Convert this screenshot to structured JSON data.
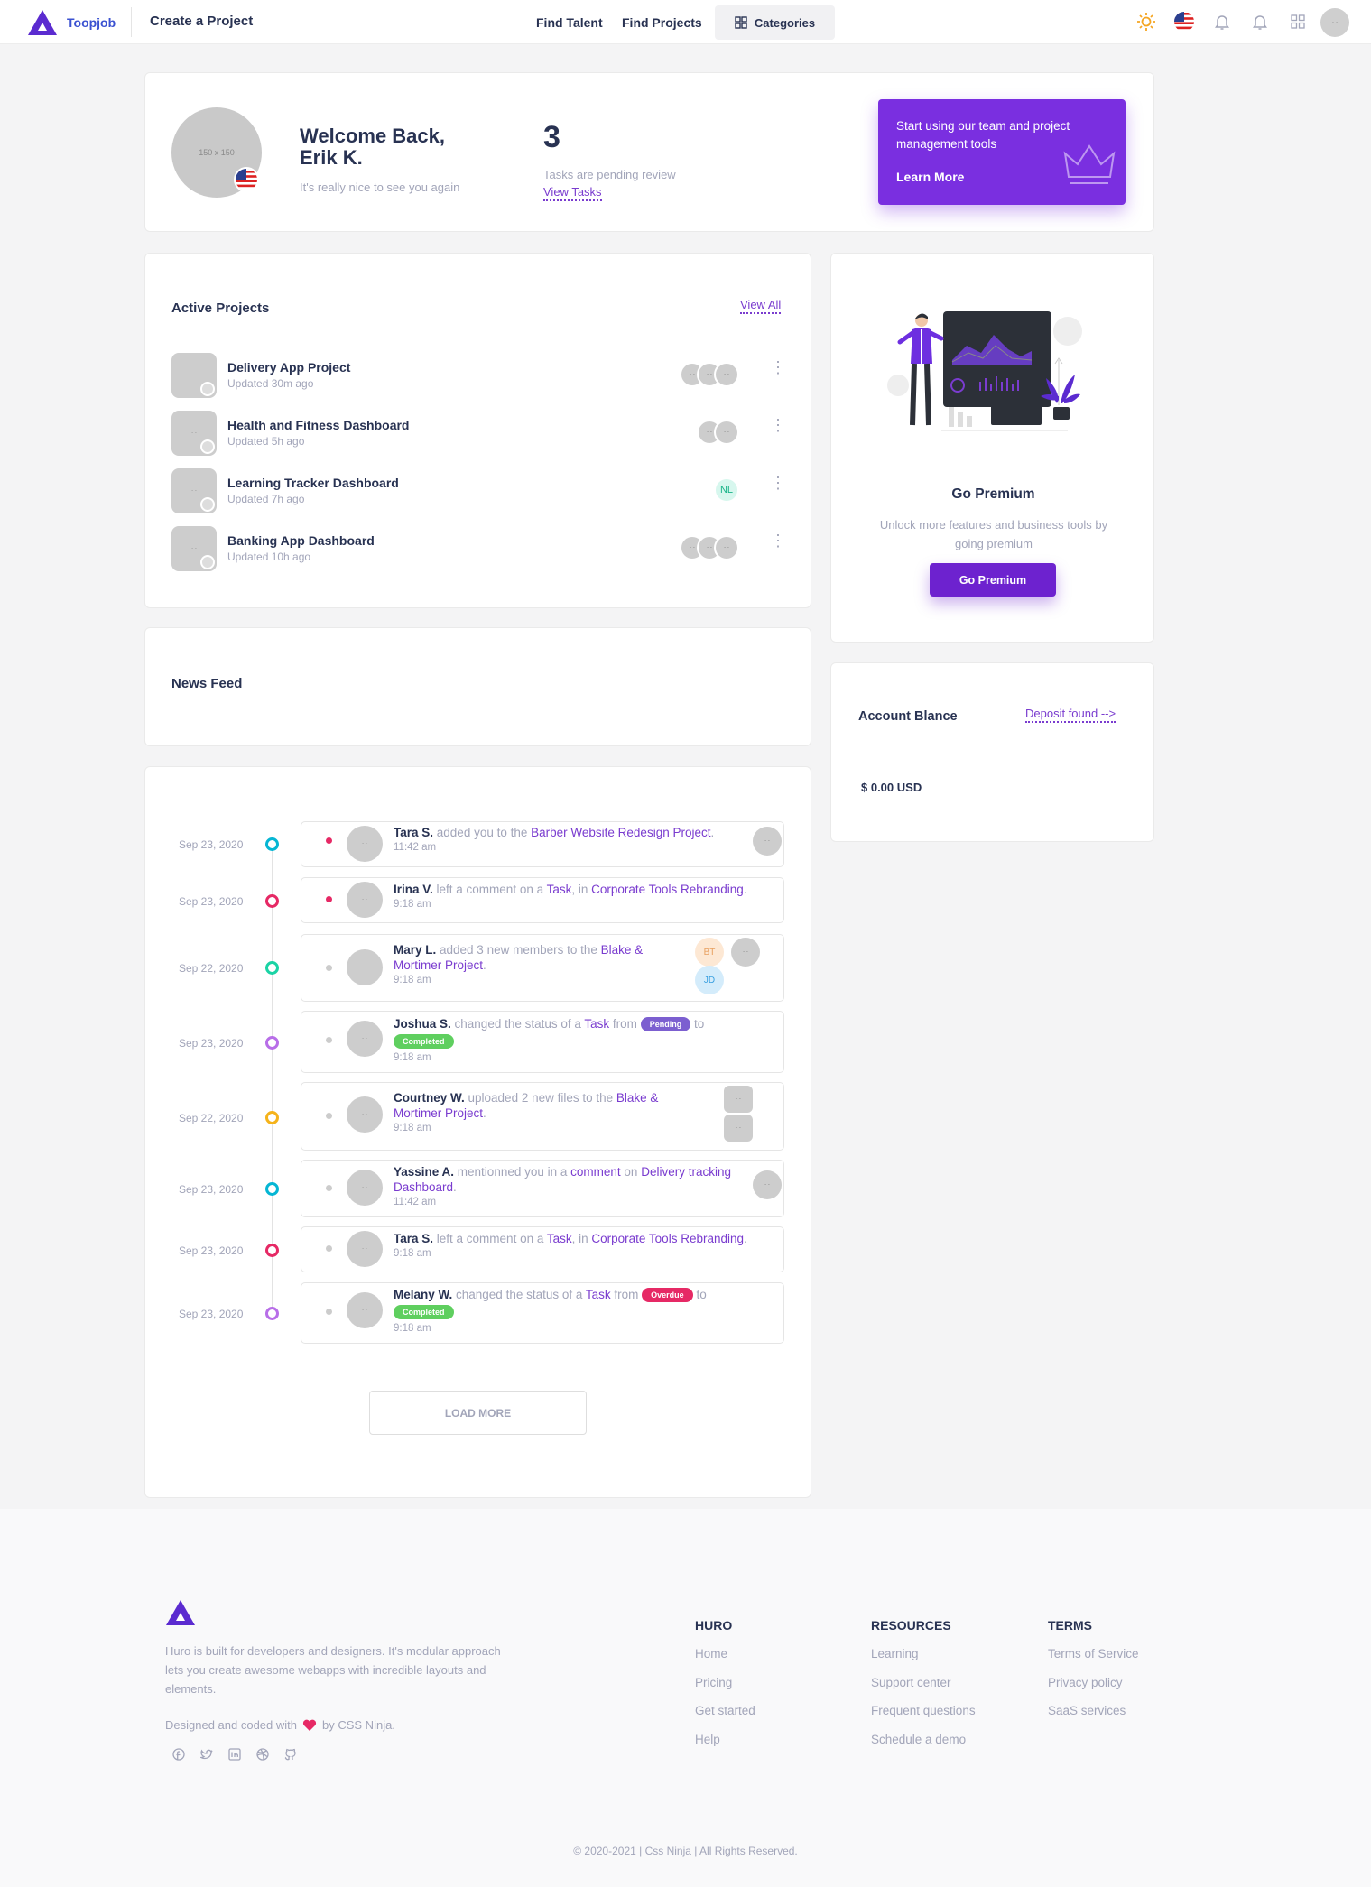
{
  "nav": {
    "brand": "Toopjob",
    "title": "Create a Project",
    "links": [
      "Find Talent",
      "Find Projects"
    ],
    "categories_label": "Categories",
    "avatar_label": "- -"
  },
  "welcome": {
    "avatar_label": "150 x 150",
    "title": "Welcome Back, Erik K.",
    "subtitle": "It's really nice to see you again",
    "tasks_count": "3",
    "tasks_label": "Tasks are pending review",
    "tasks_link": "View Tasks"
  },
  "promo": {
    "text": "Start using our team and project management tools",
    "link": "Learn More"
  },
  "active_projects": {
    "title": "Active Projects",
    "view_all": "View All",
    "items": [
      {
        "name": "Delivery App Project",
        "updated": "Updated 30m ago"
      },
      {
        "name": "Health and Fitness Dashboard",
        "updated": "Updated 5h ago"
      },
      {
        "name": "Learning Tracker Dashboard",
        "updated": "Updated 7h ago",
        "avatar_initials": "NL"
      },
      {
        "name": "Banking App Dashboard",
        "updated": "Updated 10h ago"
      }
    ]
  },
  "premium": {
    "title": "Go Premium",
    "text": "Unlock more features and business tools by going premium",
    "button": "Go Premium"
  },
  "news_feed": {
    "title": "News Feed"
  },
  "account": {
    "title": "Account Blance",
    "link": "Deposit found -->",
    "balance": "$ 0.00 USD"
  },
  "timeline": [
    {
      "date": "Sep 23, 2020",
      "color": "#06b6d4",
      "bullet": "#e62965",
      "name": "Tara S.",
      "a": " added you to the ",
      "l1": "Barber Website Redesign Project",
      "b": ".",
      "time": "11:42 am"
    },
    {
      "date": "Sep 23, 2020",
      "color": "#e62965",
      "bullet": "#e62965",
      "name": "Irina V.",
      "a": " left a comment on a ",
      "l1": "Task",
      "b": ", in ",
      "l2": "Corporate Tools Rebranding",
      "c": ".",
      "time": "9:18 am"
    },
    {
      "date": "Sep 22, 2020",
      "color": "#1bd3a5",
      "bullet": "#cccccc",
      "name": "Mary L.",
      "a": " added 3 new members to the ",
      "l1": "Blake & Mortimer Project",
      "b": ".",
      "time": "9:18 am",
      "initials": [
        "BT",
        "JD"
      ]
    },
    {
      "date": "Sep 23, 2020",
      "color": "#b86ee8",
      "bullet": "#cccccc",
      "name": "Joshua S.",
      "a": " changed the status of a ",
      "l1": "Task",
      "b": " from ",
      "pill1": "Pending",
      "c": " to ",
      "pill2": "Completed",
      "time": "9:18 am"
    },
    {
      "date": "Sep 22, 2020",
      "color": "#f5b31b",
      "bullet": "#cccccc",
      "name": "Courtney W.",
      "a": " uploaded 2 new files to the ",
      "l1": "Blake & Mortimer Project",
      "b": ".",
      "time": "9:18 am"
    },
    {
      "date": "Sep 23, 2020",
      "color": "#06b6d4",
      "bullet": "#cccccc",
      "name": "Yassine A.",
      "a": " mentionned you in a ",
      "l1": "comment",
      "b": " on ",
      "l2": "Delivery tracking Dashboard",
      "c": ".",
      "time": "11:42 am"
    },
    {
      "date": "Sep 23, 2020",
      "color": "#e62965",
      "bullet": "#cccccc",
      "name": "Tara S.",
      "a": " left a comment on a ",
      "l1": "Task",
      "b": ", in ",
      "l2": "Corporate Tools Rebranding",
      "c": ".",
      "time": "9:18 am"
    },
    {
      "date": "Sep 23, 2020",
      "color": "#b86ee8",
      "bullet": "#cccccc",
      "name": "Melany W.",
      "a": " changed the status of a ",
      "l1": "Task",
      "b": " from ",
      "pill1": "Overdue",
      "c": " to ",
      "pill2": "Completed",
      "time": "9:18 am"
    }
  ],
  "load_more": "LOAD MORE",
  "placeholder_label": "- -",
  "footer": {
    "description": "Huro is built for developers and designers. It's modular approach lets you create awesome webapps with incredible layouts and elements.",
    "made_a": "Designed and coded with",
    "made_b": "by CSS Ninja.",
    "columns": [
      {
        "title": "HURO",
        "links": [
          "Home",
          "Pricing",
          "Get started",
          "Help"
        ]
      },
      {
        "title": "RESOURCES",
        "links": [
          "Learning",
          "Support center",
          "Frequent questions",
          "Schedule a demo"
        ]
      },
      {
        "title": "TERMS",
        "links": [
          "Terms of Service",
          "Privacy policy",
          "SaaS services"
        ]
      }
    ],
    "copyright": "© 2020-2021 | Css Ninja | All Rights Reserved."
  },
  "colors": {
    "accent": "#7a2fe0",
    "heart": "#e62965",
    "pending": "#7c5fd0",
    "completed": "#5fcf5f",
    "overdue": "#e62965"
  }
}
